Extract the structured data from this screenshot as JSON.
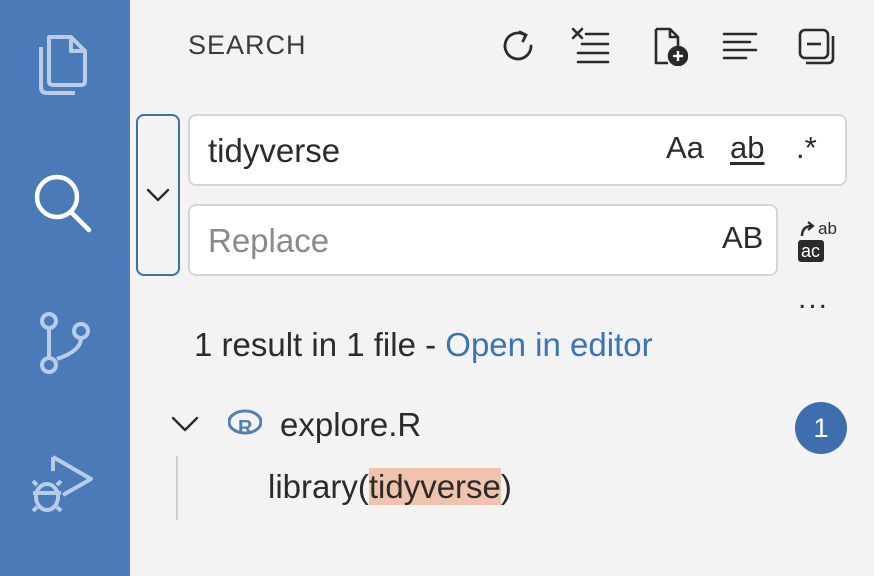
{
  "activity_bar": {
    "icons": [
      "files-icon",
      "search-icon",
      "source-control-icon",
      "run-debug-icon"
    ],
    "color": "#4a7ab8"
  },
  "panel": {
    "title": "SEARCH",
    "toolbar": [
      "refresh-icon",
      "clear-results-icon",
      "new-search-editor-icon",
      "view-as-tree-icon",
      "collapse-all-icon"
    ]
  },
  "search": {
    "value": "tidyverse",
    "options": {
      "match_case": "Aa",
      "whole_word": "ab",
      "regex": ".*"
    }
  },
  "replace": {
    "placeholder": "Replace",
    "preserve_case": "AB",
    "more": "..."
  },
  "summary": {
    "text": "1 result in 1 file - ",
    "link": "Open in editor"
  },
  "results": [
    {
      "file": "explore.R",
      "count": "1",
      "matches": [
        {
          "before": "library(",
          "match": "tidyverse",
          "after": ")"
        }
      ]
    }
  ],
  "colors": {
    "accent": "#3a74b4",
    "highlight": "#f0c4ac",
    "badge": "#3e6eae"
  }
}
